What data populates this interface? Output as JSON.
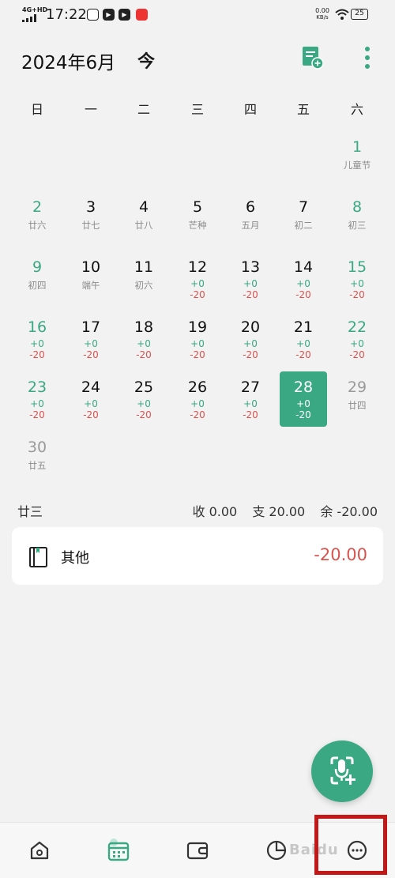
{
  "status_bar": {
    "network": "4G+HD",
    "time": "17:22",
    "app_icons": [
      "unknown-app-icon",
      "play-icon",
      "play-icon",
      "red-app-icon"
    ],
    "speed_value": "0.00",
    "speed_unit": "KB/s",
    "battery": "25"
  },
  "header": {
    "month_title": "2024年6月",
    "today_label": "今",
    "accent": "#3aa883"
  },
  "weekdays": [
    "日",
    "一",
    "二",
    "三",
    "四",
    "五",
    "六"
  ],
  "calendar": {
    "days": [
      {
        "day": "1",
        "sub": "儿童节",
        "in": "",
        "out": ""
      },
      {
        "day": "2",
        "sub": "廿六",
        "in": "",
        "out": ""
      },
      {
        "day": "3",
        "sub": "廿七",
        "in": "",
        "out": ""
      },
      {
        "day": "4",
        "sub": "廿八",
        "in": "",
        "out": ""
      },
      {
        "day": "5",
        "sub": "芒种",
        "in": "",
        "out": ""
      },
      {
        "day": "6",
        "sub": "五月",
        "in": "",
        "out": ""
      },
      {
        "day": "7",
        "sub": "初二",
        "in": "",
        "out": ""
      },
      {
        "day": "8",
        "sub": "初三",
        "in": "",
        "out": ""
      },
      {
        "day": "9",
        "sub": "初四",
        "in": "",
        "out": ""
      },
      {
        "day": "10",
        "sub": "端午",
        "in": "",
        "out": ""
      },
      {
        "day": "11",
        "sub": "初六",
        "in": "",
        "out": ""
      },
      {
        "day": "12",
        "sub": "",
        "in": "+0",
        "out": "-20"
      },
      {
        "day": "13",
        "sub": "",
        "in": "+0",
        "out": "-20"
      },
      {
        "day": "14",
        "sub": "",
        "in": "+0",
        "out": "-20"
      },
      {
        "day": "15",
        "sub": "",
        "in": "+0",
        "out": "-20"
      },
      {
        "day": "16",
        "sub": "",
        "in": "+0",
        "out": "-20"
      },
      {
        "day": "17",
        "sub": "",
        "in": "+0",
        "out": "-20"
      },
      {
        "day": "18",
        "sub": "",
        "in": "+0",
        "out": "-20"
      },
      {
        "day": "19",
        "sub": "",
        "in": "+0",
        "out": "-20"
      },
      {
        "day": "20",
        "sub": "",
        "in": "+0",
        "out": "-20"
      },
      {
        "day": "21",
        "sub": "",
        "in": "+0",
        "out": "-20"
      },
      {
        "day": "22",
        "sub": "",
        "in": "+0",
        "out": "-20"
      },
      {
        "day": "23",
        "sub": "",
        "in": "+0",
        "out": "-20"
      },
      {
        "day": "24",
        "sub": "",
        "in": "+0",
        "out": "-20"
      },
      {
        "day": "25",
        "sub": "",
        "in": "+0",
        "out": "-20"
      },
      {
        "day": "26",
        "sub": "",
        "in": "+0",
        "out": "-20"
      },
      {
        "day": "27",
        "sub": "",
        "in": "+0",
        "out": "-20"
      },
      {
        "day": "28",
        "sub": "",
        "in": "+0",
        "out": "-20",
        "selected": true
      },
      {
        "day": "29",
        "sub": "廿四",
        "in": "",
        "out": ""
      },
      {
        "day": "30",
        "sub": "廿五",
        "in": "",
        "out": ""
      }
    ]
  },
  "summary": {
    "lunar": "廿三",
    "income": "收 0.00",
    "expense": "支 20.00",
    "balance": "余 -20.00"
  },
  "record": {
    "icon": "book-icon",
    "category": "其他",
    "amount": "-20.00"
  },
  "fab": {
    "icon": "voice-add-icon"
  },
  "bottom_nav": {
    "items": [
      "home-icon",
      "calendar-icon",
      "wallet-icon",
      "chart-icon",
      "more-icon"
    ],
    "active": "calendar-icon"
  },
  "watermark": "Baidu"
}
